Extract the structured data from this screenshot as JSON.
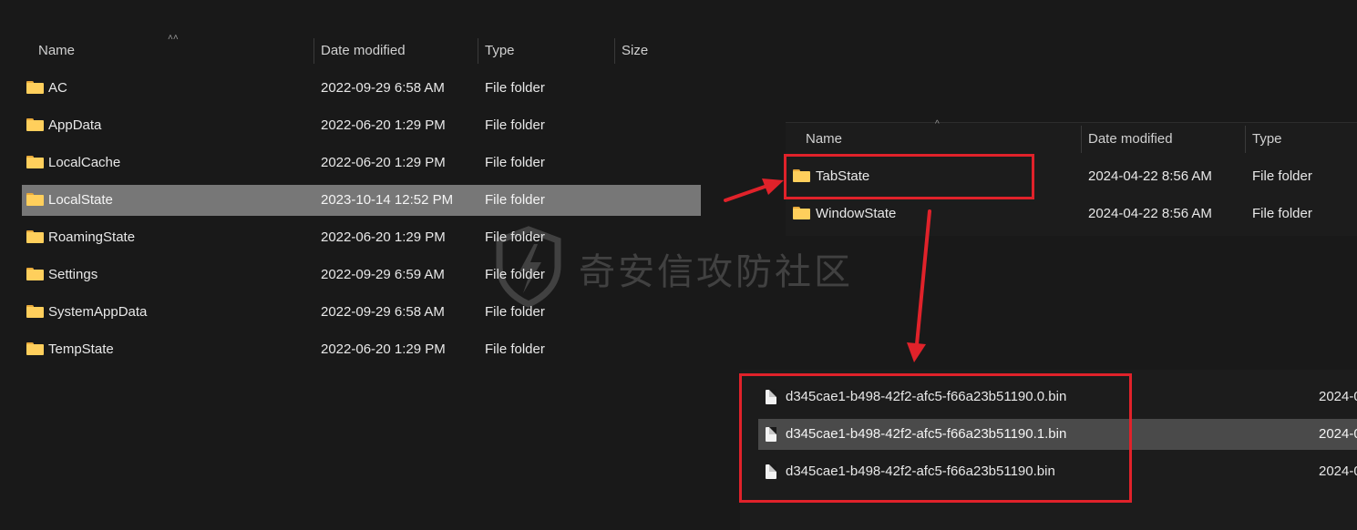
{
  "left_pane": {
    "columns": {
      "name": "Name",
      "date": "Date modified",
      "type": "Type",
      "size": "Size"
    },
    "rows": [
      {
        "name": "AC",
        "date": "2022-09-29 6:58 AM",
        "type": "File folder"
      },
      {
        "name": "AppData",
        "date": "2022-06-20 1:29 PM",
        "type": "File folder"
      },
      {
        "name": "LocalCache",
        "date": "2022-06-20 1:29 PM",
        "type": "File folder"
      },
      {
        "name": "LocalState",
        "date": "2023-10-14 12:52 PM",
        "type": "File folder",
        "selected": true
      },
      {
        "name": "RoamingState",
        "date": "2022-06-20 1:29 PM",
        "type": "File folder"
      },
      {
        "name": "Settings",
        "date": "2022-09-29 6:59 AM",
        "type": "File folder"
      },
      {
        "name": "SystemAppData",
        "date": "2022-09-29 6:58 AM",
        "type": "File folder"
      },
      {
        "name": "TempState",
        "date": "2022-06-20 1:29 PM",
        "type": "File folder"
      }
    ]
  },
  "right_top_pane": {
    "columns": {
      "name": "Name",
      "date": "Date modified",
      "type": "Type"
    },
    "rows": [
      {
        "name": "TabState",
        "date": "2024-04-22 8:56 AM",
        "type": "File folder",
        "highlighted": true
      },
      {
        "name": "WindowState",
        "date": "2024-04-22 8:56 AM",
        "type": "File folder"
      }
    ]
  },
  "right_bottom_pane": {
    "rows": [
      {
        "name": "d345cae1-b498-42f2-afc5-f66a23b51190.0.bin",
        "date": "2024-0"
      },
      {
        "name": "d345cae1-b498-42f2-afc5-f66a23b51190.1.bin",
        "date": "2024-0",
        "selected": true
      },
      {
        "name": "d345cae1-b498-42f2-afc5-f66a23b51190.bin",
        "date": "2024-0"
      }
    ]
  },
  "watermark": {
    "text": "奇安信攻防社区"
  },
  "colors": {
    "background": "#191919",
    "selected_row": "#777777",
    "annotation_red": "#e0222a",
    "folder_yellow": "#ffcf5c"
  }
}
